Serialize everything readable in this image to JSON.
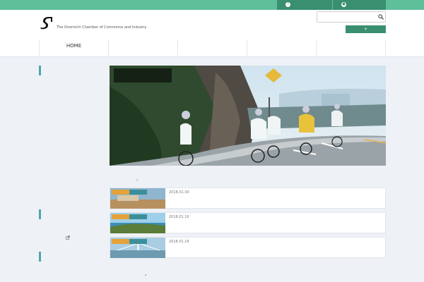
{
  "topbar": {
    "lead": "",
    "buttons": [
      "",
      ""
    ]
  },
  "header": {
    "site_name": "",
    "site_sub": "The Onomichi Chamber of Commerce and Industry",
    "search_placeholder": "",
    "small_link": "",
    "green_button": ""
  },
  "nav": {
    "items": [
      "HOME",
      "",
      "",
      "",
      ""
    ]
  },
  "sidebar": {
    "group1_title": "",
    "group1_items": [
      "",
      "",
      "",
      "",
      "",
      "",
      "",
      "",
      "",
      "",
      ""
    ],
    "group2_title": "",
    "group2_items": [
      "",
      ""
    ],
    "group3_title": "",
    "group3_items": [
      "",
      ""
    ]
  },
  "hero": {
    "title": ""
  },
  "sections": {
    "news_title": "",
    "news_more": "",
    "second_title": "",
    "second_more": ""
  },
  "news": [
    {
      "tags": [
        "",
        ""
      ],
      "date": "2018.01.30",
      "title": "",
      "excerpt": ""
    },
    {
      "tags": [
        "",
        ""
      ],
      "date": "2018.01.16",
      "title": "",
      "excerpt": ""
    },
    {
      "tags": [
        "",
        ""
      ],
      "date": "2018.01.16",
      "title": "",
      "excerpt": ""
    }
  ],
  "colors": {
    "topbar": "#5fbf9a",
    "accent_dark": "#3a8f70",
    "section_title": "#7fb9d8",
    "sidebar_accent": "#4ea8a8",
    "content_bg": "#eef1f6"
  }
}
